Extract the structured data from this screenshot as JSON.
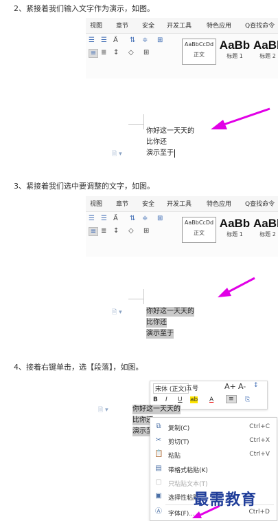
{
  "steps": [
    {
      "caption": "2、紧接着我们输入文字作为演示，如图。",
      "tabs": [
        "视图",
        "章节",
        "安全",
        "开发工具",
        "特色应用",
        "查找命令"
      ],
      "styles": [
        {
          "preview": "AaBbCcDd",
          "name": "正文"
        },
        {
          "preview": "AaBb",
          "name": "标题 1"
        },
        {
          "preview": "AaBb",
          "name": "标题 2"
        }
      ],
      "lines": [
        "你好这一天天的",
        "比你还",
        "演示至于"
      ]
    },
    {
      "caption": "3、紧接着我们选中要调整的文字，如图。",
      "tabs": [
        "视图",
        "章节",
        "安全",
        "开发工具",
        "特色应用",
        "查找命令"
      ],
      "styles": [
        {
          "preview": "AaBbCcDd",
          "name": "正文"
        },
        {
          "preview": "AaBb",
          "name": "标题 1"
        },
        {
          "preview": "AaBb",
          "name": "标题 2"
        }
      ],
      "lines": [
        "你好这一天天的",
        "比你还",
        "演示至于"
      ]
    },
    {
      "caption": "4、接着右键单击，选【段落】，如图。",
      "lines": [
        "你好这一天天的",
        "比你还",
        "演示至于"
      ]
    }
  ],
  "mini_toolbar": {
    "font": "宋体 (正文)",
    "size": "五号",
    "grow_font": "A+",
    "shrink_font": "A-",
    "line_spacing": "↕",
    "bold": "B",
    "italic": "I",
    "underline": "U",
    "highlight": "ab",
    "font_color": "A",
    "align": "≡",
    "format_painter": "⎘"
  },
  "context_menu": [
    {
      "label": "复制(C)",
      "shortcut": "Ctrl+C",
      "icon": "copy-icon",
      "disabled": false
    },
    {
      "label": "剪切(T)",
      "shortcut": "Ctrl+X",
      "icon": "scissors-icon",
      "disabled": false
    },
    {
      "label": "粘贴",
      "shortcut": "Ctrl+V",
      "icon": "paste-icon",
      "disabled": false
    },
    {
      "label": "带格式粘贴(K)",
      "shortcut": "",
      "icon": "paste-format-icon",
      "disabled": false
    },
    {
      "label": "只粘贴文本(T)",
      "shortcut": "",
      "icon": "paste-text-icon",
      "disabled": true
    },
    {
      "label": "选择性粘贴",
      "shortcut": "",
      "icon": "paste-special-icon",
      "disabled": false
    },
    {
      "label": "字体(F)...",
      "shortcut": "Ctrl+D",
      "icon": "font-icon",
      "disabled": false
    }
  ],
  "watermark": "最需教育",
  "colors": {
    "arrow": "#e100e6",
    "selection": "#c9c9c9",
    "ribbon_icon": "#3f6cb4"
  }
}
